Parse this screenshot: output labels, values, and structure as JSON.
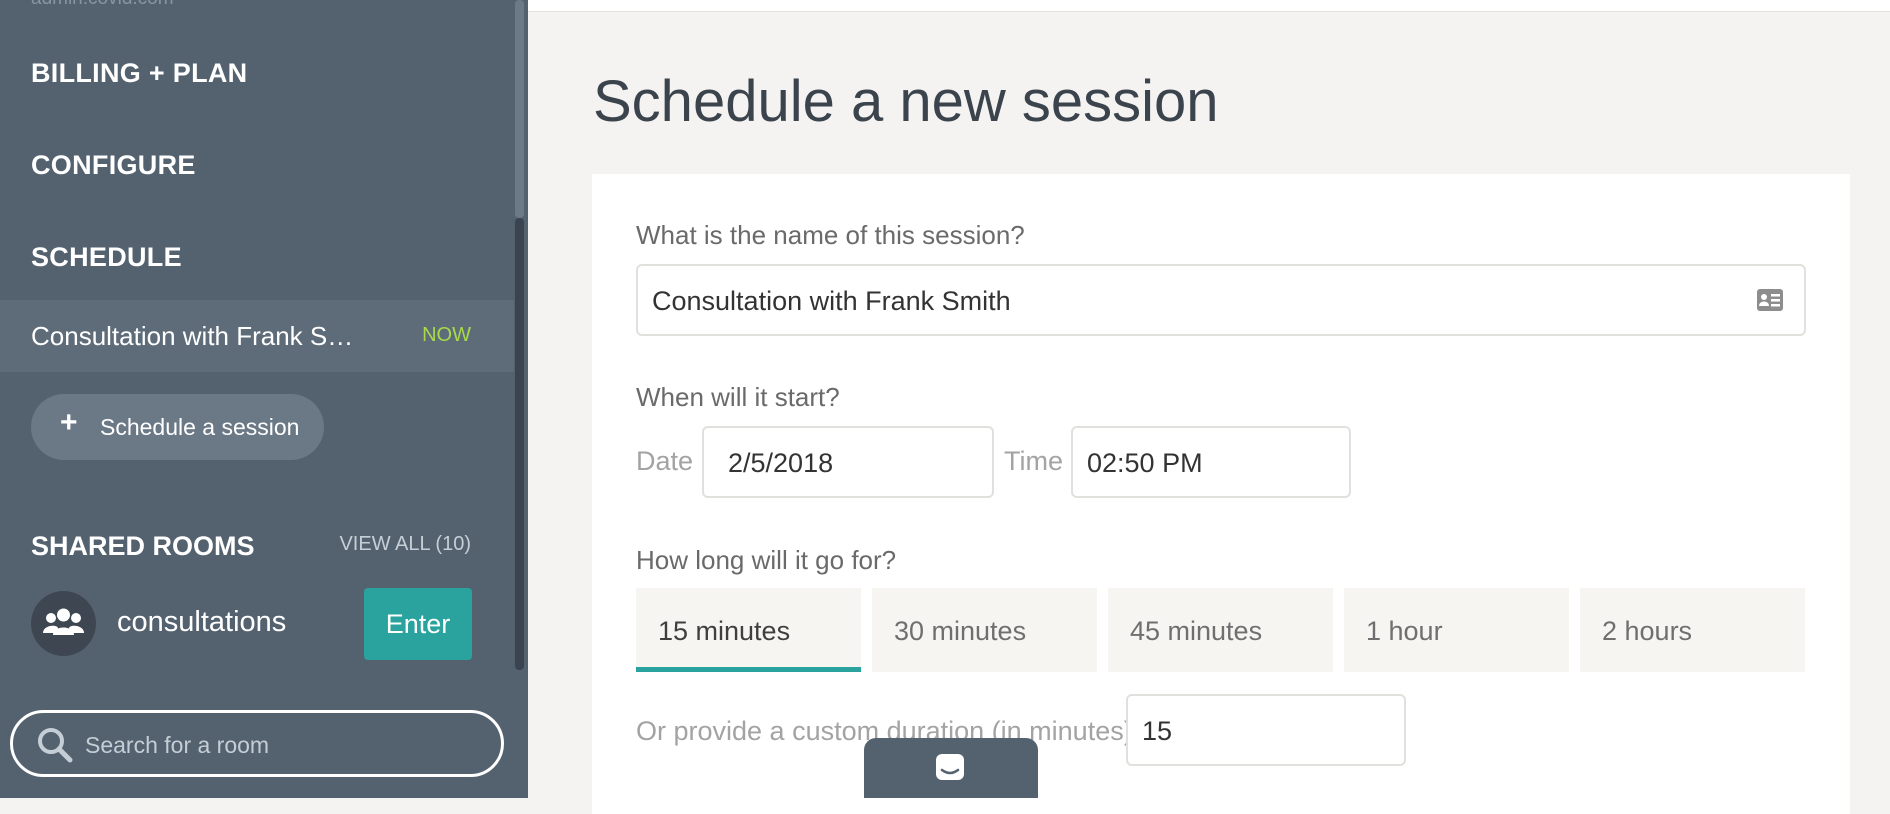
{
  "sidebar": {
    "cut_text": "admin.covid.com",
    "menu": {
      "billing": "BILLING + PLAN",
      "configure": "CONFIGURE",
      "schedule": "SCHEDULE"
    },
    "current_session": {
      "label": "Consultation with Frank Smith",
      "status": "NOW",
      "status_color": "#a7d94a"
    },
    "schedule_button": {
      "icon": "plus-icon",
      "label": "Schedule a session"
    },
    "shared_rooms": {
      "heading": "SHARED ROOMS",
      "view_all": "VIEW ALL (10)",
      "rooms": [
        {
          "icon": "group-icon",
          "name": "consultations",
          "action": "Enter"
        }
      ]
    },
    "search": {
      "icon": "search-icon",
      "placeholder": "Search for a room"
    }
  },
  "main": {
    "title": "Schedule a new session",
    "name_question": "What is the name of this session?",
    "name_value": "Consultation with Frank Smith",
    "name_icon": "contact-card-icon",
    "start_question": "When will it start?",
    "date_label": "Date",
    "date_value": "2/5/2018",
    "time_label": "Time",
    "time_value": "02:50 PM",
    "duration_question": "How long will it go for?",
    "duration_options": [
      "15 minutes",
      "30 minutes",
      "45 minutes",
      "1 hour",
      "2 hours"
    ],
    "selected_duration": "15 minutes",
    "custom_label": "Or provide a custom duration (in minutes)",
    "custom_value": "15"
  },
  "chat": {
    "icon": "chat-icon"
  },
  "colors": {
    "accent": "#2aa39e",
    "sidebar_bg": "#546270",
    "now": "#a7d94a"
  }
}
